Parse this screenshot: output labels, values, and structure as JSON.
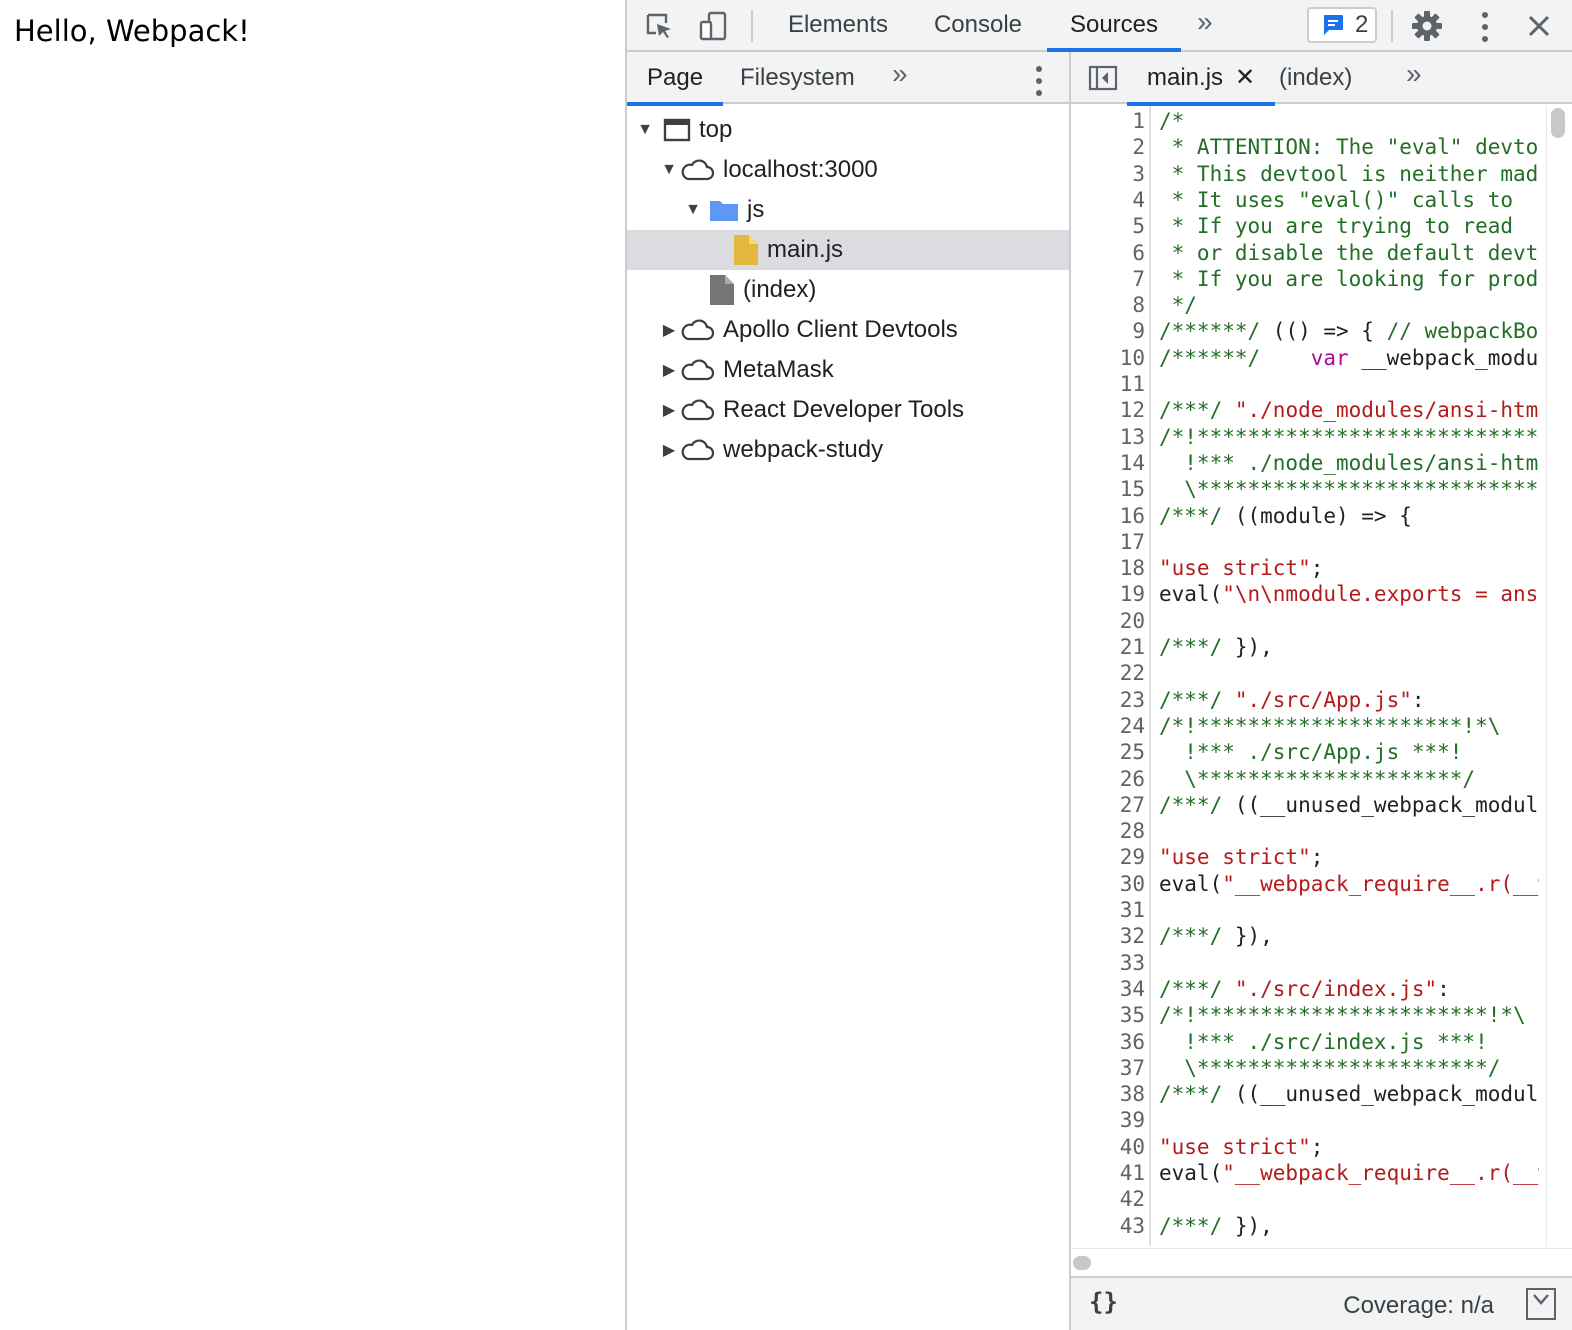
{
  "page": {
    "heading": "Hello, Webpack!"
  },
  "toolbar": {
    "tabs": [
      {
        "label": "Elements"
      },
      {
        "label": "Console"
      },
      {
        "label": "Sources"
      }
    ],
    "issues_count": "2"
  },
  "navigator": {
    "tabs": [
      {
        "label": "Page"
      },
      {
        "label": "Filesystem"
      }
    ],
    "tree": [
      {
        "label": "top"
      },
      {
        "label": "localhost:3000"
      },
      {
        "label": "js"
      },
      {
        "label": "main.js"
      },
      {
        "label": "(index)"
      },
      {
        "label": "Apollo Client Devtools"
      },
      {
        "label": "MetaMask"
      },
      {
        "label": "React Developer Tools"
      },
      {
        "label": "webpack-study"
      }
    ]
  },
  "editor": {
    "tabs": [
      {
        "label": "main.js"
      },
      {
        "label": "(index)"
      }
    ],
    "lines": [
      {
        "n": "1",
        "parts": [
          {
            "t": "/*",
            "c": "comment"
          }
        ]
      },
      {
        "n": "2",
        "parts": [
          {
            "t": " * ATTENTION: The \"eval\" devtool",
            "c": "comment"
          }
        ]
      },
      {
        "n": "3",
        "parts": [
          {
            "t": " * This devtool is neither made",
            "c": "comment"
          }
        ]
      },
      {
        "n": "4",
        "parts": [
          {
            "t": " * It uses \"eval()\" calls to",
            "c": "comment"
          }
        ]
      },
      {
        "n": "5",
        "parts": [
          {
            "t": " * If you are trying to read",
            "c": "comment"
          }
        ]
      },
      {
        "n": "6",
        "parts": [
          {
            "t": " * or disable the default devtool",
            "c": "comment"
          }
        ]
      },
      {
        "n": "7",
        "parts": [
          {
            "t": " * If you are looking for production",
            "c": "comment"
          }
        ]
      },
      {
        "n": "8",
        "parts": [
          {
            "t": " */",
            "c": "comment"
          }
        ]
      },
      {
        "n": "9",
        "parts": [
          {
            "t": "/******/",
            "c": "comment"
          },
          {
            "t": " (() => { ",
            "c": "plain"
          },
          {
            "t": "// webpackBootstrap",
            "c": "comment"
          }
        ]
      },
      {
        "n": "10",
        "parts": [
          {
            "t": "/******/",
            "c": "comment"
          },
          {
            "t": "    ",
            "c": "plain"
          },
          {
            "t": "var",
            "c": "keyword"
          },
          {
            "t": " __webpack_modules__",
            "c": "plain"
          }
        ]
      },
      {
        "n": "11",
        "parts": []
      },
      {
        "n": "12",
        "parts": [
          {
            "t": "/***/",
            "c": "comment"
          },
          {
            "t": " ",
            "c": "plain"
          },
          {
            "t": "\"./node_modules/ansi-html\"",
            "c": "string"
          }
        ]
      },
      {
        "n": "13",
        "parts": [
          {
            "t": "/*!*****************************",
            "c": "comment"
          }
        ]
      },
      {
        "n": "14",
        "parts": [
          {
            "t": "  !*** ./node_modules/ansi-html",
            "c": "comment"
          }
        ]
      },
      {
        "n": "15",
        "parts": [
          {
            "t": "  \\*****************************",
            "c": "comment"
          }
        ]
      },
      {
        "n": "16",
        "parts": [
          {
            "t": "/***/",
            "c": "comment"
          },
          {
            "t": " ((module) => {",
            "c": "plain"
          }
        ]
      },
      {
        "n": "17",
        "parts": []
      },
      {
        "n": "18",
        "parts": [
          {
            "t": "\"use strict\"",
            "c": "string"
          },
          {
            "t": ";",
            "c": "plain"
          }
        ]
      },
      {
        "n": "19",
        "parts": [
          {
            "t": "eval(",
            "c": "plain"
          },
          {
            "t": "\"\\n\\nmodule.exports = ansiHTML",
            "c": "string"
          }
        ]
      },
      {
        "n": "20",
        "parts": []
      },
      {
        "n": "21",
        "parts": [
          {
            "t": "/***/",
            "c": "comment"
          },
          {
            "t": " }),",
            "c": "plain"
          }
        ]
      },
      {
        "n": "22",
        "parts": []
      },
      {
        "n": "23",
        "parts": [
          {
            "t": "/***/",
            "c": "comment"
          },
          {
            "t": " ",
            "c": "plain"
          },
          {
            "t": "\"./src/App.js\"",
            "c": "string"
          },
          {
            "t": ":",
            "c": "plain"
          }
        ]
      },
      {
        "n": "24",
        "parts": [
          {
            "t": "/*!*********************!*\\",
            "c": "comment"
          }
        ]
      },
      {
        "n": "25",
        "parts": [
          {
            "t": "  !*** ./src/App.js ***!",
            "c": "comment"
          }
        ]
      },
      {
        "n": "26",
        "parts": [
          {
            "t": "  \\*********************/",
            "c": "comment"
          }
        ]
      },
      {
        "n": "27",
        "parts": [
          {
            "t": "/***/",
            "c": "comment"
          },
          {
            "t": " ((__unused_webpack_module",
            "c": "plain"
          }
        ]
      },
      {
        "n": "28",
        "parts": []
      },
      {
        "n": "29",
        "parts": [
          {
            "t": "\"use strict\"",
            "c": "string"
          },
          {
            "t": ";",
            "c": "plain"
          }
        ]
      },
      {
        "n": "30",
        "parts": [
          {
            "t": "eval(",
            "c": "plain"
          },
          {
            "t": "\"__webpack_require__.r(__webpack_exports__)",
            "c": "string"
          }
        ]
      },
      {
        "n": "31",
        "parts": []
      },
      {
        "n": "32",
        "parts": [
          {
            "t": "/***/",
            "c": "comment"
          },
          {
            "t": " }),",
            "c": "plain"
          }
        ]
      },
      {
        "n": "33",
        "parts": []
      },
      {
        "n": "34",
        "parts": [
          {
            "t": "/***/",
            "c": "comment"
          },
          {
            "t": " ",
            "c": "plain"
          },
          {
            "t": "\"./src/index.js\"",
            "c": "string"
          },
          {
            "t": ":",
            "c": "plain"
          }
        ]
      },
      {
        "n": "35",
        "parts": [
          {
            "t": "/*!***********************!*\\",
            "c": "comment"
          }
        ]
      },
      {
        "n": "36",
        "parts": [
          {
            "t": "  !*** ./src/index.js ***!",
            "c": "comment"
          }
        ]
      },
      {
        "n": "37",
        "parts": [
          {
            "t": "  \\***********************/",
            "c": "comment"
          }
        ]
      },
      {
        "n": "38",
        "parts": [
          {
            "t": "/***/",
            "c": "comment"
          },
          {
            "t": " ((__unused_webpack_module",
            "c": "plain"
          }
        ]
      },
      {
        "n": "39",
        "parts": []
      },
      {
        "n": "40",
        "parts": [
          {
            "t": "\"use strict\"",
            "c": "string"
          },
          {
            "t": ";",
            "c": "plain"
          }
        ]
      },
      {
        "n": "41",
        "parts": [
          {
            "t": "eval(",
            "c": "plain"
          },
          {
            "t": "\"__webpack_require__.r(__webpack_exports__)",
            "c": "string"
          }
        ]
      },
      {
        "n": "42",
        "parts": []
      },
      {
        "n": "43",
        "parts": [
          {
            "t": "/***/",
            "c": "comment"
          },
          {
            "t": " }),",
            "c": "plain"
          }
        ]
      }
    ]
  },
  "status": {
    "pretty_print": "{}",
    "coverage": "Coverage: n/a"
  },
  "colors": {
    "accent": "#1a73e8",
    "comment": "#236e25",
    "string": "#b21b1c",
    "keyword": "#aa0d91",
    "folder": "#5e97f6",
    "js_file": "#e2b93d",
    "index_file": "#757575"
  },
  "icons": {
    "inspect": "inspect-element-icon",
    "device": "device-toolbar-icon",
    "issues": "issues-message-icon",
    "settings": "gear-icon",
    "more": "kebab-menu-icon",
    "close": "close-icon",
    "frame": "frame-window-icon",
    "domain": "cloud-icon",
    "folder": "folder-icon",
    "file": "file-icon",
    "toggle_navigator": "toggle-navigator-icon",
    "coverage": "coverage-icon"
  }
}
